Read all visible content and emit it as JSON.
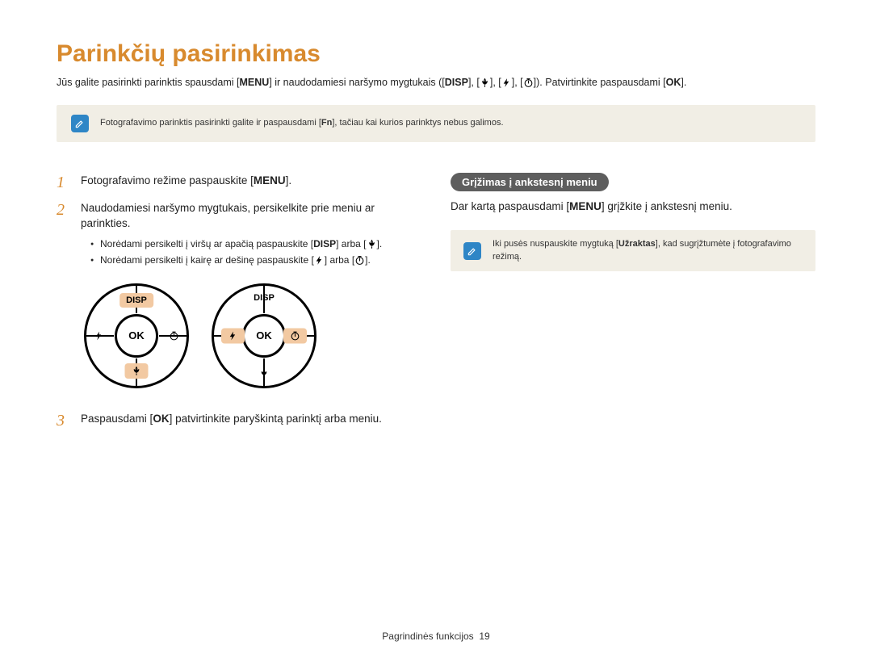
{
  "title": "Parinkčių pasirinkimas",
  "intro": {
    "p1": "Jūs galite pasirinkti parinktis spausdami [",
    "menu": "MENU",
    "p2": "] ir naudodamiesi naršymo mygtukais ([",
    "disp": "DISP",
    "p3": "], [",
    "p4": "], [",
    "p5": "], [",
    "p6": "]). Patvirtinkite paspausdami [",
    "ok": "OK",
    "p7": "]."
  },
  "topnote": {
    "a": "Fotografavimo parinktis pasirinkti galite ir paspausdami [",
    "fn": "Fn",
    "b": "], tačiau kai kurios parinktys nebus galimos."
  },
  "steps": {
    "s1": {
      "num": "1",
      "a": "Fotografavimo režime paspauskite [",
      "menu": "MENU",
      "b": "]."
    },
    "s2": {
      "num": "2",
      "text": "Naudodamiesi naršymo mygtukais, persikelkite prie meniu ar parinkties.",
      "b1a": "Norėdami persikelti į viršų ar apačią paspauskite [",
      "b1disp": "DISP",
      "b1b": "] arba [",
      "b1c": "].",
      "b2a": "Norėdami persikelti į kairę ar dešinę paspauskite [",
      "b2b": "] arba [",
      "b2c": "]."
    },
    "s3": {
      "num": "3",
      "a": "Paspausdami [",
      "ok": "OK",
      "b": "] patvirtinkite paryškintą parinktį arba meniu."
    }
  },
  "dpad": {
    "top": "DISP",
    "center": "OK"
  },
  "right": {
    "pill": "Grįžimas į ankstesnį meniu",
    "a": "Dar kartą paspausdami [",
    "menu": "MENU",
    "b": "] grįžkite į ankstesnį meniu.",
    "note_a": "Iki pusės nuspauskite mygtuką [",
    "note_bold": "Užraktas",
    "note_b": "], kad sugrįžtumėte į fotografavimo režimą."
  },
  "footer": {
    "label": "Pagrindinės funkcijos",
    "page": "19"
  }
}
